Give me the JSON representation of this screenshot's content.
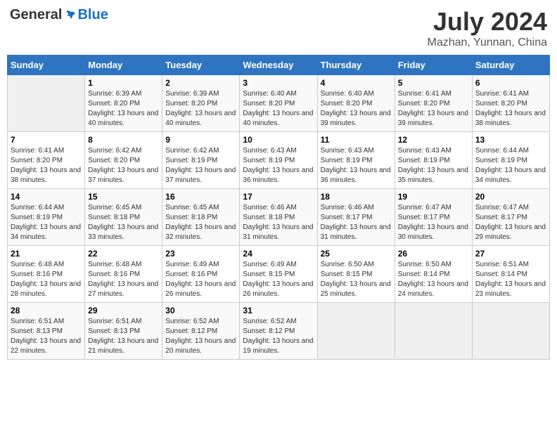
{
  "header": {
    "logo_general": "General",
    "logo_blue": "Blue",
    "month_year": "July 2024",
    "location": "Mazhan, Yunnan, China"
  },
  "days_of_week": [
    "Sunday",
    "Monday",
    "Tuesday",
    "Wednesday",
    "Thursday",
    "Friday",
    "Saturday"
  ],
  "weeks": [
    [
      {
        "day": "",
        "sunrise": "",
        "sunset": "",
        "daylight": ""
      },
      {
        "day": "1",
        "sunrise": "Sunrise: 6:39 AM",
        "sunset": "Sunset: 8:20 PM",
        "daylight": "Daylight: 13 hours and 40 minutes."
      },
      {
        "day": "2",
        "sunrise": "Sunrise: 6:39 AM",
        "sunset": "Sunset: 8:20 PM",
        "daylight": "Daylight: 13 hours and 40 minutes."
      },
      {
        "day": "3",
        "sunrise": "Sunrise: 6:40 AM",
        "sunset": "Sunset: 8:20 PM",
        "daylight": "Daylight: 13 hours and 40 minutes."
      },
      {
        "day": "4",
        "sunrise": "Sunrise: 6:40 AM",
        "sunset": "Sunset: 8:20 PM",
        "daylight": "Daylight: 13 hours and 39 minutes."
      },
      {
        "day": "5",
        "sunrise": "Sunrise: 6:41 AM",
        "sunset": "Sunset: 8:20 PM",
        "daylight": "Daylight: 13 hours and 39 minutes."
      },
      {
        "day": "6",
        "sunrise": "Sunrise: 6:41 AM",
        "sunset": "Sunset: 8:20 PM",
        "daylight": "Daylight: 13 hours and 38 minutes."
      }
    ],
    [
      {
        "day": "7",
        "sunrise": "Sunrise: 6:41 AM",
        "sunset": "Sunset: 8:20 PM",
        "daylight": "Daylight: 13 hours and 38 minutes."
      },
      {
        "day": "8",
        "sunrise": "Sunrise: 6:42 AM",
        "sunset": "Sunset: 8:20 PM",
        "daylight": "Daylight: 13 hours and 37 minutes."
      },
      {
        "day": "9",
        "sunrise": "Sunrise: 6:42 AM",
        "sunset": "Sunset: 8:19 PM",
        "daylight": "Daylight: 13 hours and 37 minutes."
      },
      {
        "day": "10",
        "sunrise": "Sunrise: 6:43 AM",
        "sunset": "Sunset: 8:19 PM",
        "daylight": "Daylight: 13 hours and 36 minutes."
      },
      {
        "day": "11",
        "sunrise": "Sunrise: 6:43 AM",
        "sunset": "Sunset: 8:19 PM",
        "daylight": "Daylight: 13 hours and 36 minutes."
      },
      {
        "day": "12",
        "sunrise": "Sunrise: 6:43 AM",
        "sunset": "Sunset: 8:19 PM",
        "daylight": "Daylight: 13 hours and 35 minutes."
      },
      {
        "day": "13",
        "sunrise": "Sunrise: 6:44 AM",
        "sunset": "Sunset: 8:19 PM",
        "daylight": "Daylight: 13 hours and 34 minutes."
      }
    ],
    [
      {
        "day": "14",
        "sunrise": "Sunrise: 6:44 AM",
        "sunset": "Sunset: 8:19 PM",
        "daylight": "Daylight: 13 hours and 34 minutes."
      },
      {
        "day": "15",
        "sunrise": "Sunrise: 6:45 AM",
        "sunset": "Sunset: 8:18 PM",
        "daylight": "Daylight: 13 hours and 33 minutes."
      },
      {
        "day": "16",
        "sunrise": "Sunrise: 6:45 AM",
        "sunset": "Sunset: 8:18 PM",
        "daylight": "Daylight: 13 hours and 32 minutes."
      },
      {
        "day": "17",
        "sunrise": "Sunrise: 6:46 AM",
        "sunset": "Sunset: 8:18 PM",
        "daylight": "Daylight: 13 hours and 31 minutes."
      },
      {
        "day": "18",
        "sunrise": "Sunrise: 6:46 AM",
        "sunset": "Sunset: 8:17 PM",
        "daylight": "Daylight: 13 hours and 31 minutes."
      },
      {
        "day": "19",
        "sunrise": "Sunrise: 6:47 AM",
        "sunset": "Sunset: 8:17 PM",
        "daylight": "Daylight: 13 hours and 30 minutes."
      },
      {
        "day": "20",
        "sunrise": "Sunrise: 6:47 AM",
        "sunset": "Sunset: 8:17 PM",
        "daylight": "Daylight: 13 hours and 29 minutes."
      }
    ],
    [
      {
        "day": "21",
        "sunrise": "Sunrise: 6:48 AM",
        "sunset": "Sunset: 8:16 PM",
        "daylight": "Daylight: 13 hours and 28 minutes."
      },
      {
        "day": "22",
        "sunrise": "Sunrise: 6:48 AM",
        "sunset": "Sunset: 8:16 PM",
        "daylight": "Daylight: 13 hours and 27 minutes."
      },
      {
        "day": "23",
        "sunrise": "Sunrise: 6:49 AM",
        "sunset": "Sunset: 8:16 PM",
        "daylight": "Daylight: 13 hours and 26 minutes."
      },
      {
        "day": "24",
        "sunrise": "Sunrise: 6:49 AM",
        "sunset": "Sunset: 8:15 PM",
        "daylight": "Daylight: 13 hours and 26 minutes."
      },
      {
        "day": "25",
        "sunrise": "Sunrise: 6:50 AM",
        "sunset": "Sunset: 8:15 PM",
        "daylight": "Daylight: 13 hours and 25 minutes."
      },
      {
        "day": "26",
        "sunrise": "Sunrise: 6:50 AM",
        "sunset": "Sunset: 8:14 PM",
        "daylight": "Daylight: 13 hours and 24 minutes."
      },
      {
        "day": "27",
        "sunrise": "Sunrise: 6:51 AM",
        "sunset": "Sunset: 8:14 PM",
        "daylight": "Daylight: 13 hours and 23 minutes."
      }
    ],
    [
      {
        "day": "28",
        "sunrise": "Sunrise: 6:51 AM",
        "sunset": "Sunset: 8:13 PM",
        "daylight": "Daylight: 13 hours and 22 minutes."
      },
      {
        "day": "29",
        "sunrise": "Sunrise: 6:51 AM",
        "sunset": "Sunset: 8:13 PM",
        "daylight": "Daylight: 13 hours and 21 minutes."
      },
      {
        "day": "30",
        "sunrise": "Sunrise: 6:52 AM",
        "sunset": "Sunset: 8:12 PM",
        "daylight": "Daylight: 13 hours and 20 minutes."
      },
      {
        "day": "31",
        "sunrise": "Sunrise: 6:52 AM",
        "sunset": "Sunset: 8:12 PM",
        "daylight": "Daylight: 13 hours and 19 minutes."
      },
      {
        "day": "",
        "sunrise": "",
        "sunset": "",
        "daylight": ""
      },
      {
        "day": "",
        "sunrise": "",
        "sunset": "",
        "daylight": ""
      },
      {
        "day": "",
        "sunrise": "",
        "sunset": "",
        "daylight": ""
      }
    ]
  ]
}
